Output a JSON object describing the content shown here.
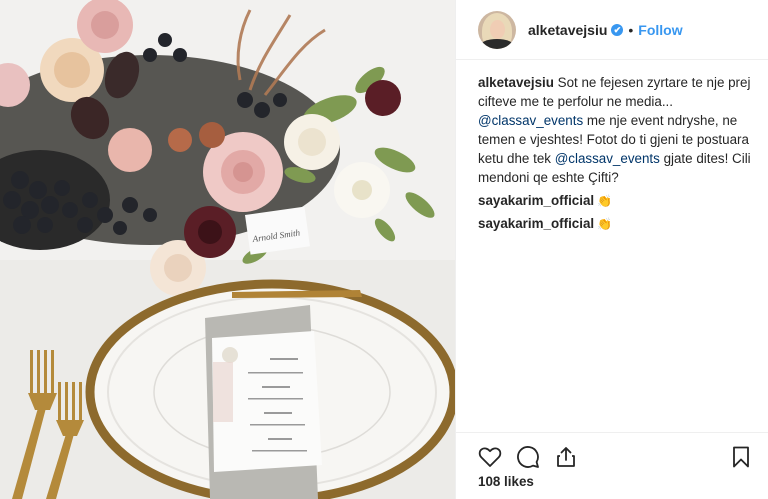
{
  "post": {
    "username": "alketavejsiu",
    "verified_badge": "✔",
    "separator": "•",
    "follow_label": "Follow",
    "caption": {
      "username": "alketavejsiu",
      "part1": " Sot ne fejesen zyrtare te nje prej cifteve me te perfolur ne media... ",
      "mention1": "@classav_events",
      "part2": " me nje event ndryshe, ne temen e vjeshtes! Fotot do ti gjeni te postuara ketu dhe tek ",
      "mention2": "@classav_events",
      "part3": " gjate dites! Cili mendoni qe eshte Çifti?"
    },
    "comments": [
      {
        "username": "sayakarim_official",
        "emoji": "👏"
      },
      {
        "username": "sayakarim_official",
        "emoji": "👏"
      }
    ],
    "likes": "108 likes"
  },
  "icons": {
    "like": "heart-icon",
    "comment": "comment-icon",
    "share": "share-icon",
    "save": "bookmark-icon",
    "verified": "verified-badge-icon"
  },
  "photo": {
    "card_text": "Arnold Smith",
    "menu_lines": [
      "APPETIZER",
      "FIRST COURSE",
      "MAIN COURSE",
      "DESSERT"
    ]
  },
  "colors": {
    "accent": "#3897f0",
    "mention": "#003569",
    "text": "#262626",
    "border": "#efefef"
  }
}
